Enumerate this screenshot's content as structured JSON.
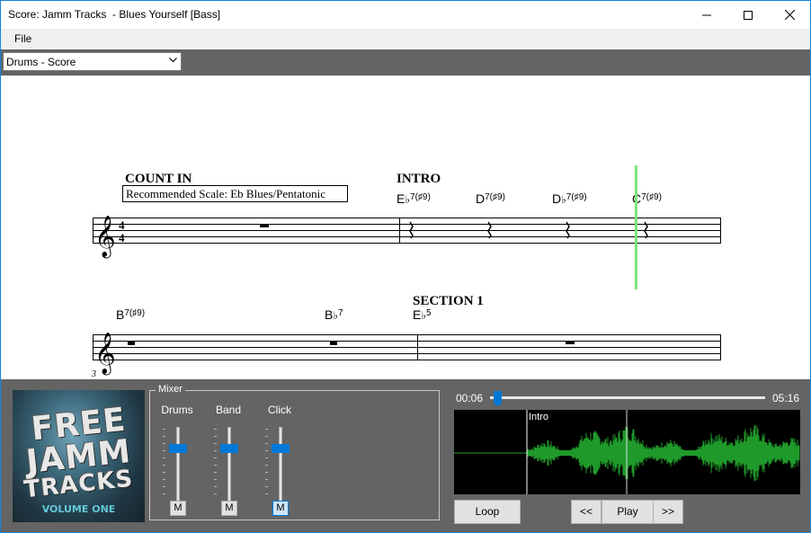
{
  "window": {
    "title": "Score: Jamm Tracks  - Blues Yourself [Bass]"
  },
  "menu": {
    "file": "File"
  },
  "toolbar": {
    "track_select": "Drums - Score"
  },
  "score": {
    "row1": {
      "section_count_in": "COUNT IN",
      "scale_note": "Recommended Scale: Eb Blues/Pentatonic",
      "section_intro": "INTRO",
      "time_signature_top": "4",
      "time_signature_bottom": "4",
      "chords": [
        {
          "root": "E",
          "accidental": "♭",
          "ext": "7(♯9)"
        },
        {
          "root": "D",
          "accidental": "",
          "ext": "7(♯9)"
        },
        {
          "root": "D",
          "accidental": "♭",
          "ext": "7(♯9)"
        },
        {
          "root": "C",
          "accidental": "",
          "ext": "7(♯9)"
        }
      ]
    },
    "row2": {
      "section_1": "SECTION 1",
      "measure_number": "3",
      "chords": [
        {
          "root": "B",
          "accidental": "",
          "ext": "7(♯9)"
        },
        {
          "root": "B",
          "accidental": "♭",
          "ext": "7"
        },
        {
          "root": "E",
          "accidental": "♭",
          "ext": "5"
        }
      ]
    },
    "playhead_color": "#7ee37a"
  },
  "album": {
    "line1": "FREE",
    "line2": "JAMM",
    "line3": "TRACKS",
    "volume": "VOLUME ONE"
  },
  "mixer": {
    "legend": "Mixer",
    "channels": [
      {
        "name": "Drums",
        "mute_label": "M",
        "muted": false
      },
      {
        "name": "Band",
        "mute_label": "M",
        "muted": false
      },
      {
        "name": "Click",
        "mute_label": "M",
        "muted": true
      }
    ]
  },
  "transport": {
    "current_time": "00:06",
    "total_time": "05:16",
    "waveform_marker": "Intro",
    "loop": "Loop",
    "rewind": "<<",
    "play": "Play",
    "forward": ">>"
  },
  "colors": {
    "panel_bg": "#646464",
    "accent": "#0078d7",
    "waveform": "#1f9a2a"
  }
}
